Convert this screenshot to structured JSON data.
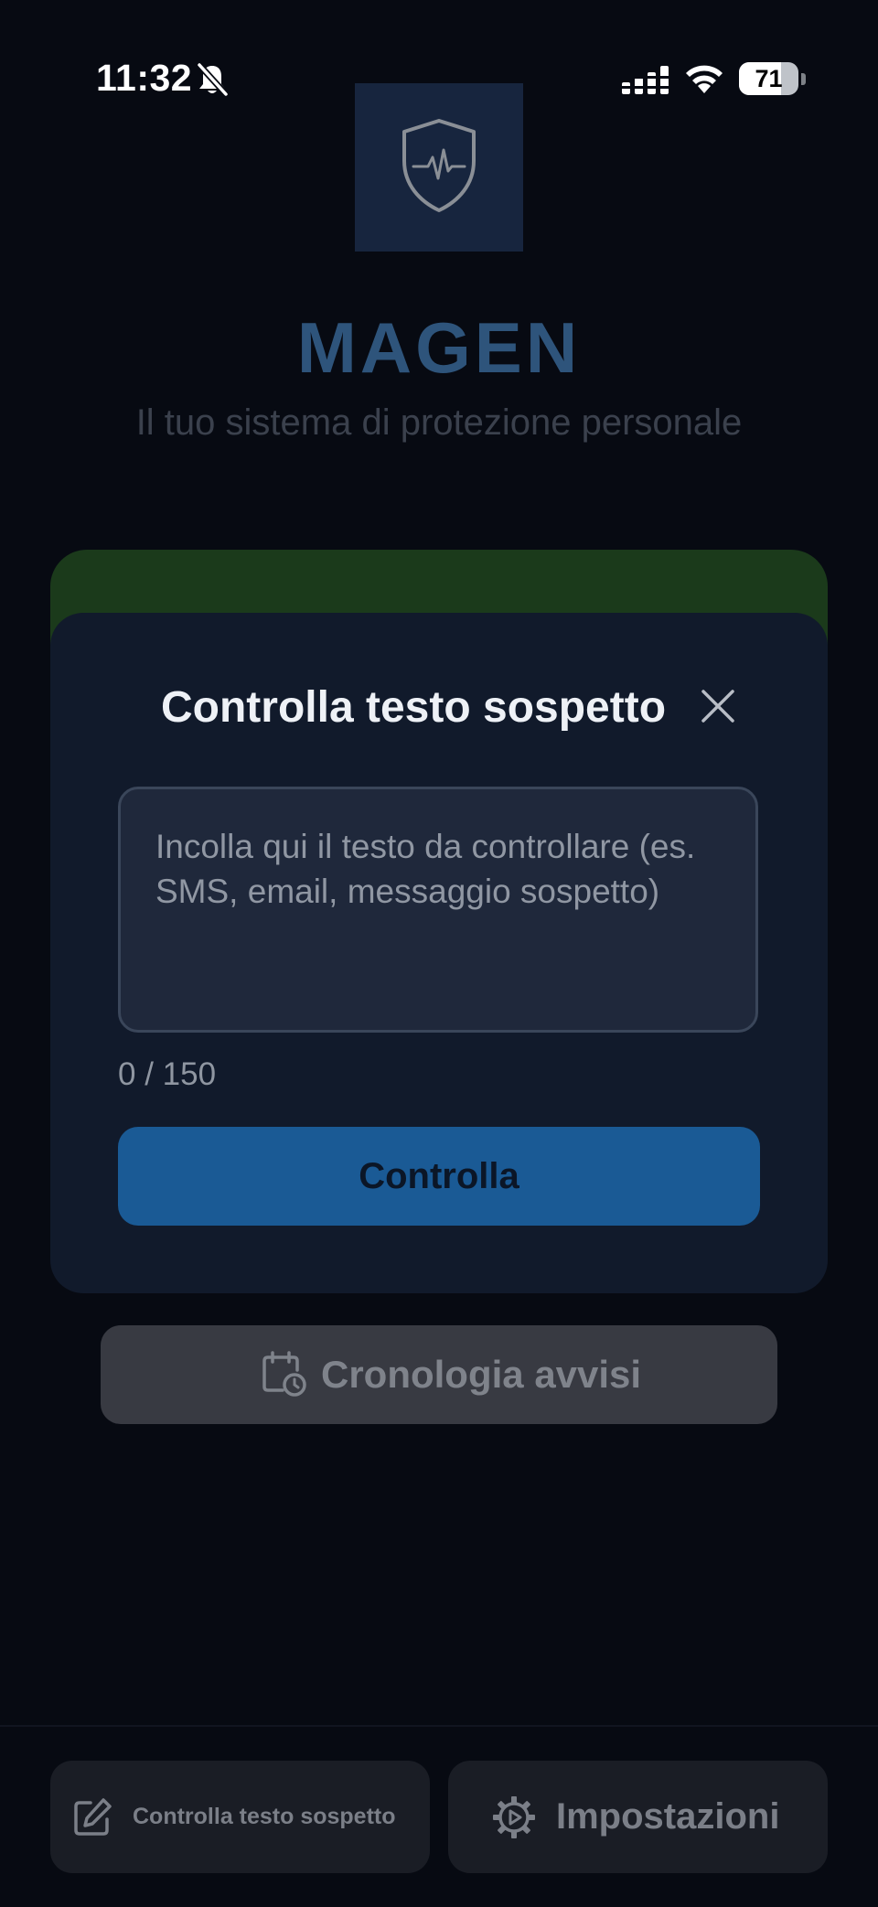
{
  "status_bar": {
    "time": "11:32",
    "battery_level": 71,
    "battery_label": "71",
    "icons": [
      "bell-slash-icon",
      "cellular-signal-icon",
      "wifi-icon",
      "battery-icon"
    ]
  },
  "app": {
    "logo_icon": "shield-heartbeat-icon",
    "title": "MAGEN",
    "subtitle": "Il tuo sistema di protezione personale"
  },
  "modal": {
    "title": "Controlla testo sospetto",
    "close_icon": "close-icon",
    "input_placeholder": "Incolla qui il testo da controllare (es. SMS, email, messaggio sospetto)",
    "input_value": "",
    "char_count": "0 / 150",
    "submit_label": "Controlla"
  },
  "history_button": {
    "icon": "calendar-clock-icon",
    "label": "Cronologia avvisi"
  },
  "bottom_bar": {
    "check_text": {
      "icon": "edit-icon",
      "label": "Controlla testo sospetto"
    },
    "settings": {
      "icon": "gear-icon",
      "label": "Impostazioni"
    }
  },
  "colors": {
    "background": "#070a12",
    "brand": "#2e547b",
    "primary_button": "#1a5a95",
    "modal": "#111a2b",
    "success_card": "#1b3a1b"
  }
}
